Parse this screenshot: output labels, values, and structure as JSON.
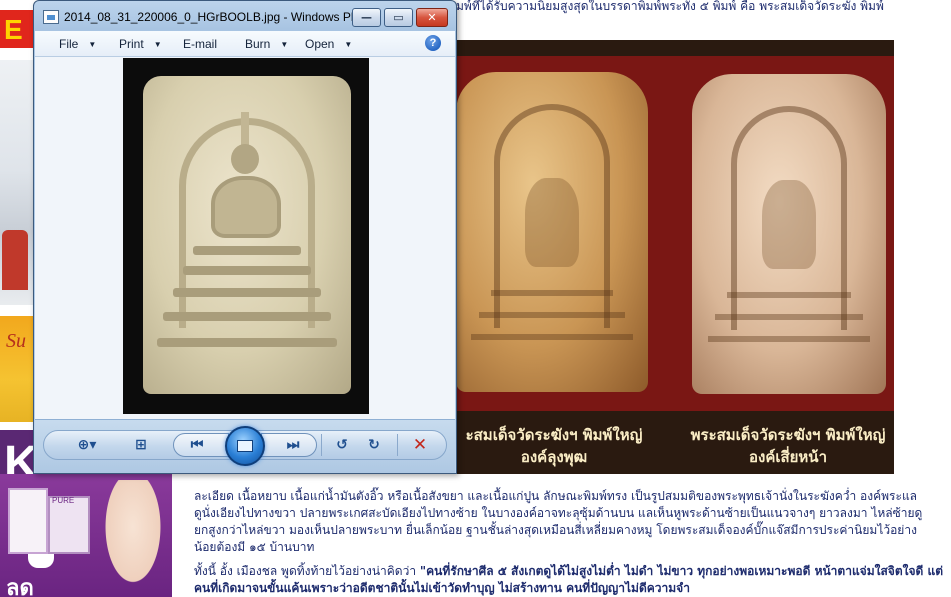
{
  "window": {
    "title": "2014_08_31_220006_0_HGrBOOLB.jpg - Windows Ph...",
    "min_label": "—",
    "max_label": "▭",
    "close_label": "✕"
  },
  "menu": {
    "file": "File",
    "print": "Print",
    "email": "E-mail",
    "burn": "Burn",
    "open": "Open",
    "help": "?"
  },
  "controls": {
    "zoom_icon": "zoom-icon",
    "zoom_glyph": "⊕▾",
    "actual_size_glyph": "⊞",
    "prev_glyph": "⏮",
    "next_glyph": "⏭",
    "rotate_ccw_glyph": "↺",
    "rotate_cw_glyph": "↻",
    "delete_glyph": "✕"
  },
  "page": {
    "header_text": "มพ์ที่ได้รับความนิยมสูงสุดในบรรดาพิมพ์พระทั้ง ๕ พิมพ์ คือ พระสมเด็จวัดระฆัง พิมพ์",
    "ad_top_letter": "E",
    "ad_yellow_text": "Su",
    "ad_purple_letter": "K",
    "promo_brand": "PURE",
    "promo_big": "ลด",
    "captions": [
      {
        "line1": "ะสมเด็จวัดระฆังฯ พิมพ์ใหญ่",
        "line2": "องค์ลุงพุฒ"
      },
      {
        "line1": "พระสมเด็จวัดระฆังฯ พิมพ์ใหญ่",
        "line2": "องค์เสี่ยหน้า"
      }
    ],
    "article_p1": "ละเอียด เนื้อหยาบ เนื้อแก่น้ำมันตังอิ๊ว หรือเนื้อสังขยา และเนื้อแก่ปูน ลักษณะพิมพ์ทรง เป็นรูปสมมติของพระพุทธเจ้านั่งในระฆังคว่ำ องค์พระแลดูนั่งเอียงไปทางขวา ปลายพระเกศสะบัดเอียงไปทางซ้าย ในบางองค์อาจทะลุซุ้มด้านบน แลเห็นหูพระด้านซ้ายเป็นแนวจางๆ ยาวลงมา ไหล่ซ้ายดูยกสูงกว่าไหล่ขวา มองเห็นปลายพระบาท ยื่นเล็กน้อย ฐานชั้นล่างสุดเหมือนสี่เหลี่ยมคางหมู โดยพระสมเด็จองค์บั๊กแจ๊สมีการประค่านิยมไว้อย่างน้อยต้องมี ๑๕ บ้านบาท",
    "article_p2_start": "ทั้งนี้ อั้ง เมืองชล พูดทิ้งท้ายไว้อย่างน่าคิดว่า ",
    "article_p2_bold": "\"คนที่รักษาศีล ๕ สังเกตดูได้ไม่สูงไม่ต่ำ ไม่ดำ ไม่ขาว ทุกอย่างพอเหมาะพอดี หน้าตาแจ่มใสจิตใจดี แต่คนที่เกิดมาจนขั้นแค้นเพราะว่าอดีตชาตินั้นไม่เข้าวัดทำบุญ ไม่สร้างทาน คนที่ปัญญาไม่ดีความจำ"
  }
}
